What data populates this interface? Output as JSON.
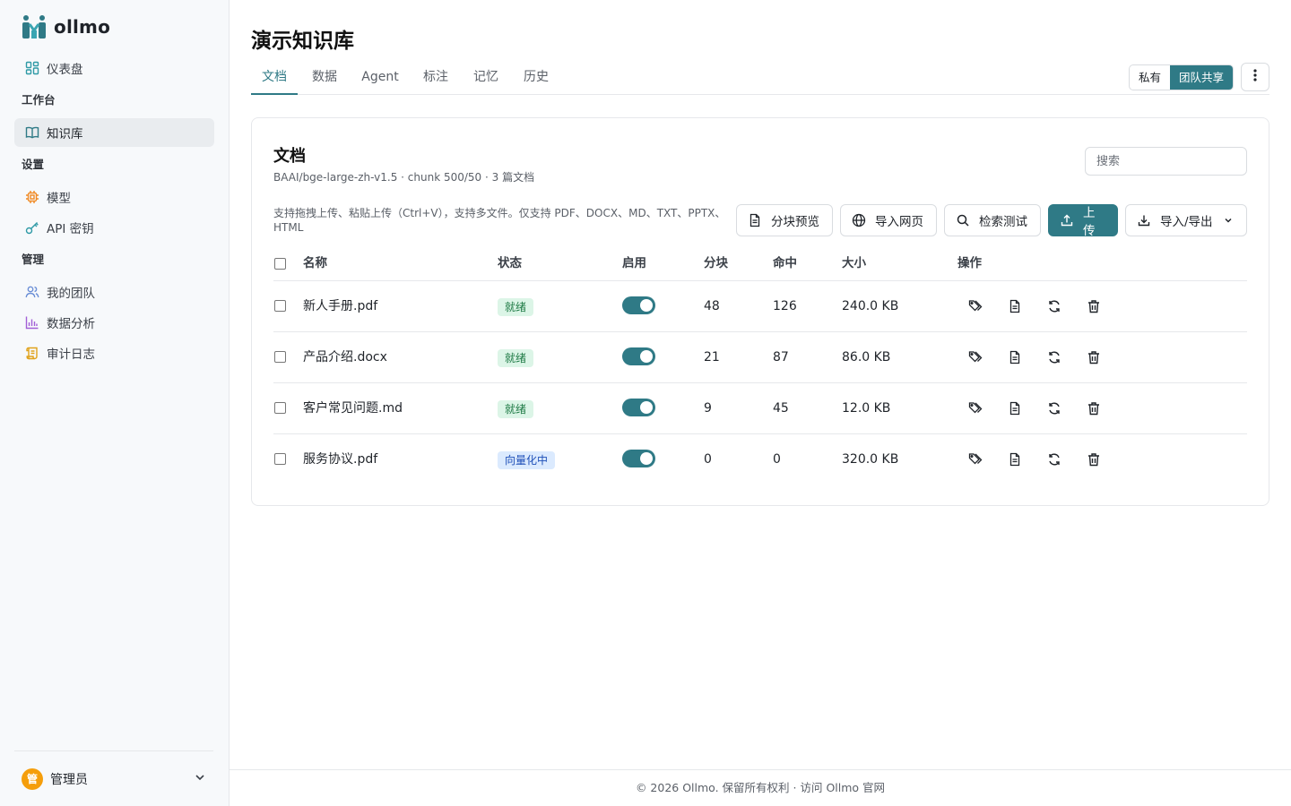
{
  "app": {
    "name": "ollmo"
  },
  "sidebar": {
    "dashboard": "仪表盘",
    "sections": [
      {
        "title": "工作台",
        "items": [
          {
            "label": "知识库",
            "icon": "book-icon",
            "active": true
          }
        ]
      },
      {
        "title": "设置",
        "items": [
          {
            "label": "模型",
            "icon": "chip-icon"
          },
          {
            "label": "API 密钥",
            "icon": "key-icon"
          }
        ]
      },
      {
        "title": "管理",
        "items": [
          {
            "label": "我的团队",
            "icon": "team-icon"
          },
          {
            "label": "数据分析",
            "icon": "bar-chart-icon"
          },
          {
            "label": "审计日志",
            "icon": "scroll-icon"
          }
        ]
      }
    ],
    "user": {
      "avatar_text": "管",
      "name": "管理员"
    }
  },
  "page": {
    "title": "演示知识库",
    "tabs": [
      "文档",
      "数据",
      "Agent",
      "标注",
      "记忆",
      "历史"
    ],
    "active_tab": 0,
    "visibility": {
      "private": "私有",
      "team": "团队共享",
      "selected": "团队共享"
    }
  },
  "card": {
    "title": "文档",
    "subtitle": "BAAI/bge-large-zh-v1.5 · chunk 500/50 · 3 篇文档",
    "search_placeholder": "搜索",
    "hint": "支持拖拽上传、粘贴上传（Ctrl+V），支持多文件。仅支持 PDF、DOCX、MD、TXT、PPTX、HTML",
    "buttons": {
      "chunk_preview": "分块预览",
      "import_web": "导入网页",
      "search_test": "检索测试",
      "upload": "上传",
      "import_export": "导入/导出"
    },
    "columns": [
      "名称",
      "状态",
      "启用",
      "分块",
      "命中",
      "大小",
      "操作"
    ],
    "rows": [
      {
        "name": "新人手册.pdf",
        "status": "就绪",
        "status_type": "ready",
        "enabled": true,
        "chunks": "48",
        "hits": "126",
        "size": "240.0 KB"
      },
      {
        "name": "产品介绍.docx",
        "status": "就绪",
        "status_type": "ready",
        "enabled": true,
        "chunks": "21",
        "hits": "87",
        "size": "86.0 KB"
      },
      {
        "name": "客户常见问题.md",
        "status": "就绪",
        "status_type": "ready",
        "enabled": true,
        "chunks": "9",
        "hits": "45",
        "size": "12.0 KB"
      },
      {
        "name": "服务协议.pdf",
        "status": "向量化中",
        "status_type": "vectorizing",
        "enabled": true,
        "chunks": "0",
        "hits": "0",
        "size": "320.0 KB"
      }
    ]
  },
  "footer": {
    "text": "© 2026 Ollmo. 保留所有权利 · 访问 Ollmo 官网"
  },
  "colors": {
    "accent": "#2f7a86",
    "ready_bg": "#dcf5e7",
    "vectorizing_bg": "#dbeafe",
    "avatar": "#f59e0b"
  }
}
